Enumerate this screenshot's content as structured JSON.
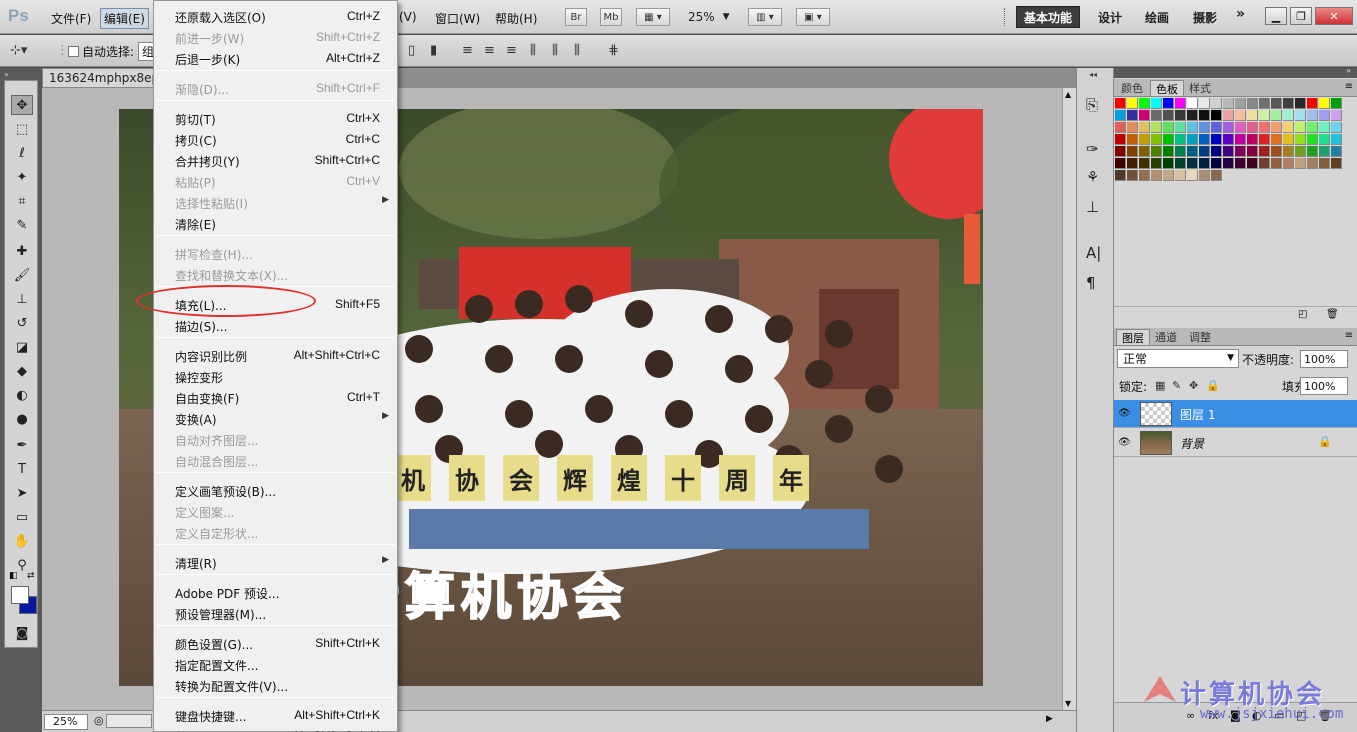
{
  "menubar": {
    "logo": "Ps",
    "items": [
      "文件(F)",
      "编辑(E)",
      "(V)",
      "窗口(W)",
      "帮助(H)"
    ],
    "bridge": "Br",
    "minibridge": "Mb",
    "zoom": "25%",
    "workspaces": {
      "active": "基本功能",
      "design": "设计",
      "paint": "绘画",
      "photo": "摄影",
      "more": "»"
    }
  },
  "options": {
    "auto_select_label": "自动选择:",
    "group_value": "组"
  },
  "document": {
    "tab_title": "163624mphpx8epz",
    "zoom_level": "25%"
  },
  "photo": {
    "banner_chars": [
      "机",
      "协",
      "会",
      "辉",
      "煌",
      "十",
      "周",
      "年"
    ],
    "overlay_text": "计算机协会"
  },
  "edit_menu": {
    "items": [
      {
        "label": "还原载入选区(O)",
        "shortcut": "Ctrl+Z",
        "disabled": false
      },
      {
        "label": "前进一步(W)",
        "shortcut": "Shift+Ctrl+Z",
        "disabled": true
      },
      {
        "label": "后退一步(K)",
        "shortcut": "Alt+Ctrl+Z",
        "disabled": false
      },
      {
        "label": "渐隐(D)...",
        "shortcut": "Shift+Ctrl+F",
        "disabled": true
      },
      {
        "label": "剪切(T)",
        "shortcut": "Ctrl+X",
        "disabled": false
      },
      {
        "label": "拷贝(C)",
        "shortcut": "Ctrl+C",
        "disabled": false
      },
      {
        "label": "合并拷贝(Y)",
        "shortcut": "Shift+Ctrl+C",
        "disabled": false
      },
      {
        "label": "粘贴(P)",
        "shortcut": "Ctrl+V",
        "disabled": true
      },
      {
        "label": "选择性粘贴(I)",
        "shortcut": "",
        "disabled": true,
        "submenu": true
      },
      {
        "label": "清除(E)",
        "shortcut": "",
        "disabled": false
      },
      {
        "label": "拼写检查(H)...",
        "shortcut": "",
        "disabled": true
      },
      {
        "label": "查找和替换文本(X)...",
        "shortcut": "",
        "disabled": true
      },
      {
        "label": "填充(L)...",
        "shortcut": "Shift+F5",
        "disabled": false
      },
      {
        "label": "描边(S)...",
        "shortcut": "",
        "disabled": false
      },
      {
        "label": "内容识别比例",
        "shortcut": "Alt+Shift+Ctrl+C",
        "disabled": false
      },
      {
        "label": "操控变形",
        "shortcut": "",
        "disabled": false
      },
      {
        "label": "自由变换(F)",
        "shortcut": "Ctrl+T",
        "disabled": false
      },
      {
        "label": "变换(A)",
        "shortcut": "",
        "disabled": false,
        "submenu": true
      },
      {
        "label": "自动对齐图层...",
        "shortcut": "",
        "disabled": true
      },
      {
        "label": "自动混合图层...",
        "shortcut": "",
        "disabled": true
      },
      {
        "label": "定义画笔预设(B)...",
        "shortcut": "",
        "disabled": false
      },
      {
        "label": "定义图案...",
        "shortcut": "",
        "disabled": true
      },
      {
        "label": "定义自定形状...",
        "shortcut": "",
        "disabled": true
      },
      {
        "label": "清理(R)",
        "shortcut": "",
        "disabled": false,
        "submenu": true
      },
      {
        "label": "Adobe PDF 预设...",
        "shortcut": "",
        "disabled": false
      },
      {
        "label": "预设管理器(M)...",
        "shortcut": "",
        "disabled": false
      },
      {
        "label": "颜色设置(G)...",
        "shortcut": "Shift+Ctrl+K",
        "disabled": false
      },
      {
        "label": "指定配置文件...",
        "shortcut": "",
        "disabled": false
      },
      {
        "label": "转换为配置文件(V)...",
        "shortcut": "",
        "disabled": false
      },
      {
        "label": "键盘快捷键...",
        "shortcut": "Alt+Shift+Ctrl+K",
        "disabled": false
      },
      {
        "label": "菜单(U)...",
        "shortcut": "Alt+Shift+Ctrl+M",
        "disabled": false
      }
    ]
  },
  "color_panel": {
    "tabs": [
      "颜色",
      "色板",
      "样式"
    ],
    "active_tab": "色板"
  },
  "layers_panel": {
    "tabs": [
      "图层",
      "通道",
      "调整"
    ],
    "active_tab": "图层",
    "blend_mode": "正常",
    "opacity_label": "不透明度:",
    "opacity": "100%",
    "lock_label": "锁定:",
    "fill_label": "填充:",
    "fill": "100%",
    "layers": [
      {
        "name": "图层 1",
        "selected": true
      },
      {
        "name": "背景",
        "selected": false
      }
    ]
  },
  "colors": {
    "accent_selected": "#3a8ee6",
    "highlight_ellipse": "#e03030",
    "foreground": "#ffffff",
    "background": "#0a1aa0"
  },
  "watermark": {
    "text": "计算机协会",
    "url": "www.jsjxiehui.com"
  }
}
